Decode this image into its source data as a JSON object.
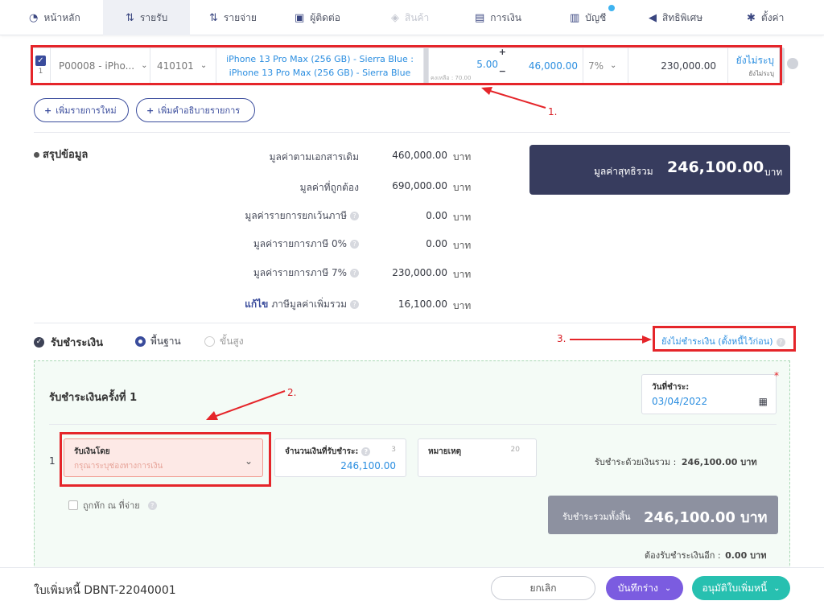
{
  "nav": [
    {
      "label": "หน้าหลัก",
      "icon": "speedometer-icon"
    },
    {
      "label": "รายรับ",
      "icon": "income-icon"
    },
    {
      "label": "รายจ่าย",
      "icon": "expense-icon"
    },
    {
      "label": "ผู้ติดต่อ",
      "icon": "contacts-icon"
    },
    {
      "label": "สินค้า",
      "icon": "product-icon"
    },
    {
      "label": "การเงิน",
      "icon": "money-icon"
    },
    {
      "label": "บัญชี",
      "icon": "accounting-icon"
    },
    {
      "label": "สิทธิพิเศษ",
      "icon": "megaphone-icon"
    },
    {
      "label": "ตั้งค่า",
      "icon": "gear-icon"
    }
  ],
  "item": {
    "index": "1",
    "product": "P00008 - iPho...",
    "account": "410101",
    "description_line1": "iPhone 13 Pro Max (256 GB) - Sierra Blue :",
    "description_line2": "iPhone 13 Pro Max (256 GB) - Sierra Blue",
    "remaining": "คงเหลือ : 70.00",
    "quantity": "5.00",
    "price": "46,000.00",
    "vat": "7%",
    "amount": "230,000.00",
    "tag_main": "ยังไม่ระบุ",
    "tag_sub": "ยังไม่ระบุ"
  },
  "buttons": {
    "add_item": "เพิ่มรายการใหม่",
    "add_description": "เพิ่มคำอธิบายรายการ"
  },
  "annotations": {
    "one": "1.",
    "two": "2.",
    "three": "3."
  },
  "summary": {
    "title": "สรุปข้อมูล",
    "rows": [
      {
        "label": "มูลค่าตามเอกสารเดิม",
        "value": "460,000.00",
        "unit": "บาท"
      },
      {
        "label": "มูลค่าที่ถูกต้อง",
        "value": "690,000.00",
        "unit": "บาท"
      },
      {
        "label": "มูลค่ารายการยกเว้นภาษี",
        "value": "0.00",
        "unit": "บาท"
      },
      {
        "label": "มูลค่ารายการภาษี 0%",
        "value": "0.00",
        "unit": "บาท"
      },
      {
        "label": "มูลค่ารายการภาษี 7%",
        "value": "230,000.00",
        "unit": "บาท"
      },
      {
        "label": "ภาษีมูลค่าเพิ่มรวม",
        "value": "16,100.00",
        "unit": "บาท",
        "edit": "แก้ไข"
      }
    ],
    "net_label": "มูลค่าสุทธิรวม",
    "net_value": "246,100.00",
    "net_unit": "บาท"
  },
  "payment": {
    "title": "รับชำระเงิน",
    "mode_basic": "พื้นฐาน",
    "mode_advanced": "ขั้นสูง",
    "unpaid_link": "ยังไม่ชำระเงิน (ตั้งหนี้ไว้ก่อน)",
    "installment_title": "รับชำระเงินครั้งที่ 1",
    "date_label": "วันที่ชำระ:",
    "date_value": "03/04/2022",
    "row_index": "1",
    "method_label": "รับเงินโดย",
    "method_placeholder": "กรุณาระบุช่องทางการเงิน",
    "amount_label": "จำนวนเงินที่รับชำระ:",
    "amount_counter": "3",
    "amount_value": "246,100.00",
    "note_label": "หมายเหตุ",
    "note_counter": "20",
    "total_cash_label": "รับชำระด้วยเงินรวม :",
    "total_cash_value": "246,100.00 บาท",
    "withholding": "ถูกหัก ณ ที่จ่าย",
    "grand_label": "รับชำระรวมทั้งสิ้น",
    "grand_value": "246,100.00 บาท",
    "remaining_label": "ต้องรับชำระเงินอีก :",
    "remaining_value": "0.00 บาท"
  },
  "footer": {
    "doc_title": "ใบเพิ่มหนี้ DBNT-22040001",
    "cancel": "ยกเลิก",
    "save_draft": "บันทึกร่าง",
    "approve": "อนุมัติใบเพิ่มหนี้"
  },
  "colors": {
    "accent": "#3a4c9c",
    "link": "#2b8ee0",
    "annotation": "#e5252a",
    "net_bg": "#373c5e",
    "approve": "#27c0b0",
    "draft": "#7b5ce0"
  }
}
